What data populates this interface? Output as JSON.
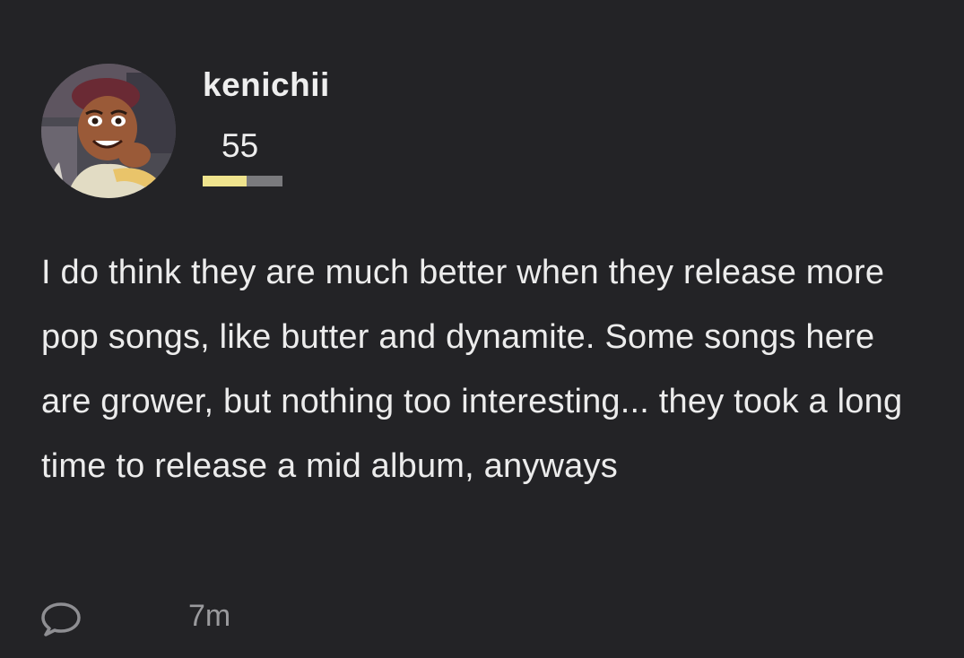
{
  "post": {
    "username": "kenichii",
    "score": "55",
    "score_level": 0.55,
    "score_bar_colors": {
      "fill": "#efe38d",
      "track": "#7a7a7d"
    },
    "text": "I do think they are much better when they release more pop songs, like butter and dynamite. Some songs here are grower, but nothing too interesting... they took a long time to release a mid album, anyways",
    "time_ago": "7m",
    "comment_icon": "speech-bubble-icon"
  },
  "colors": {
    "background": "#232326",
    "text": "#ececec",
    "muted": "#9a9a9d"
  }
}
